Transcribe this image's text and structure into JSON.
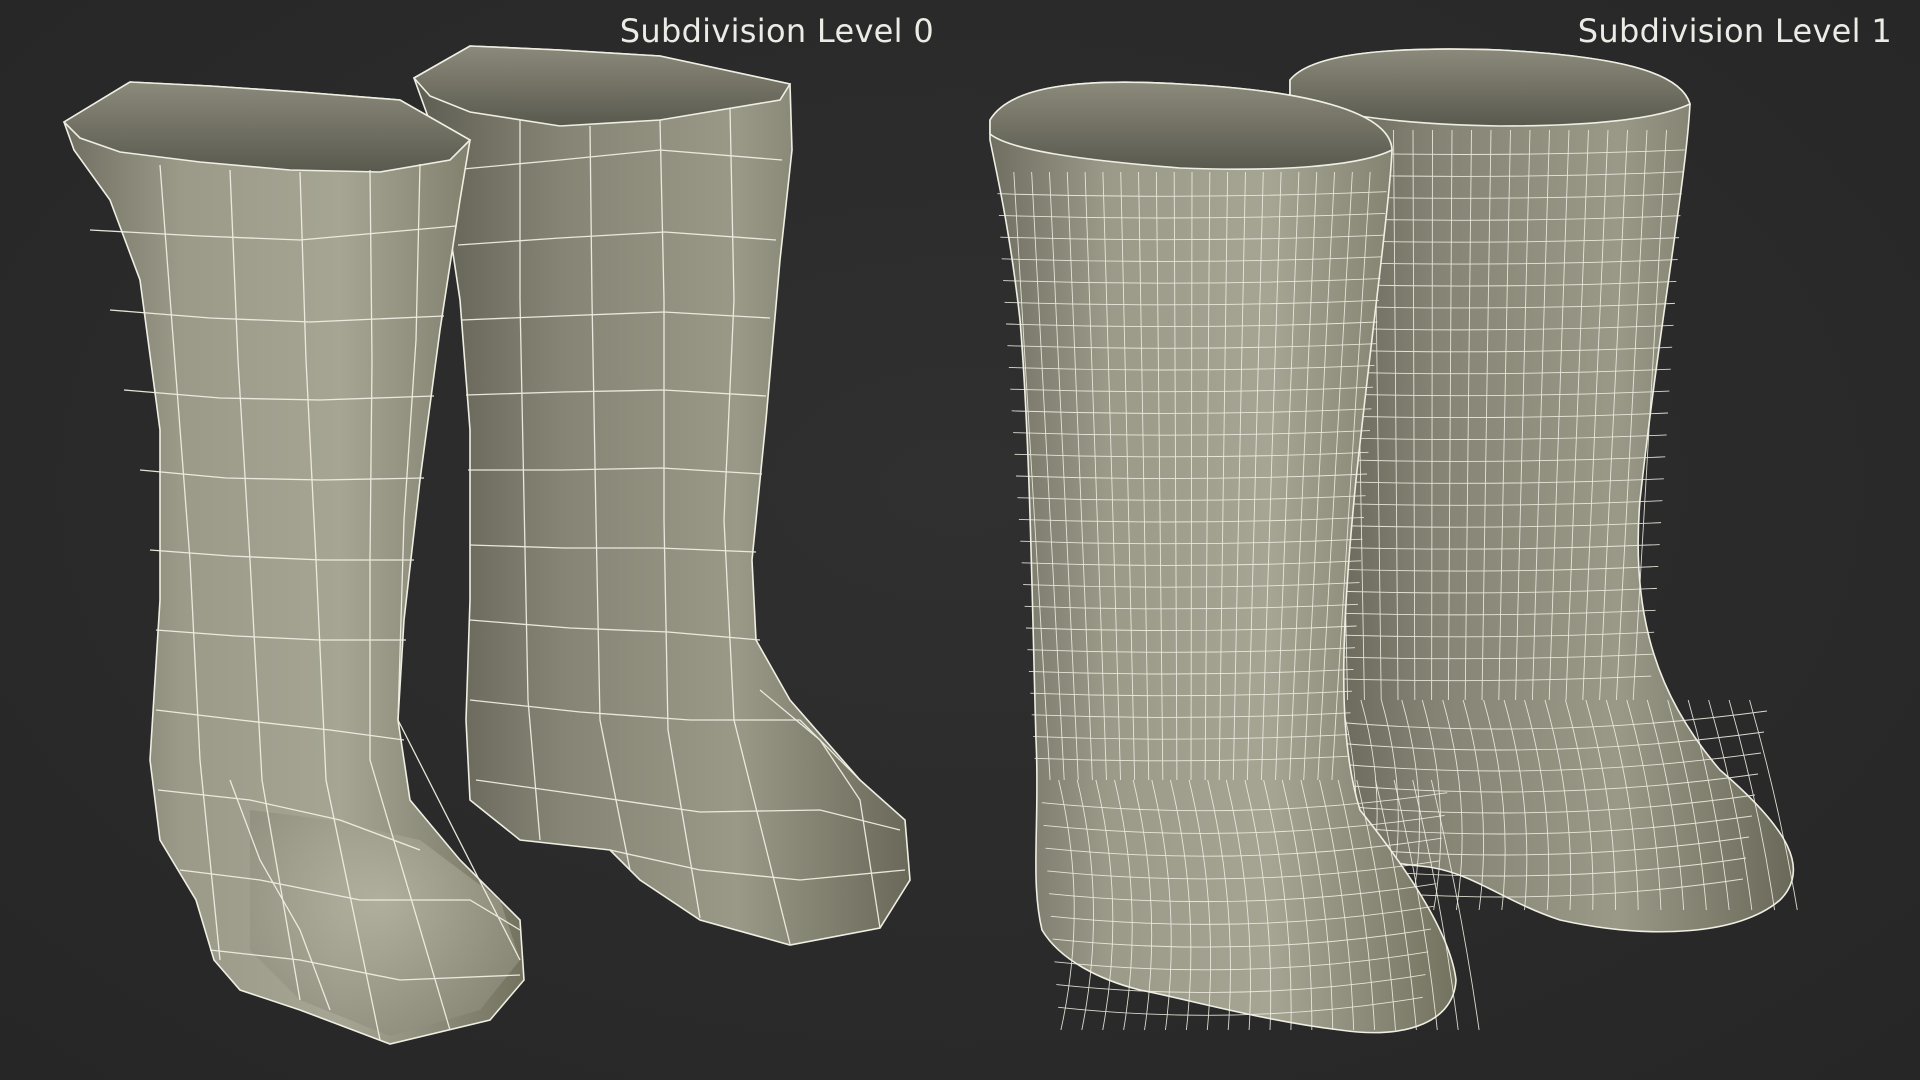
{
  "labels": {
    "left": "Subdivision Level 0",
    "right": "Subdivision Level 1"
  },
  "colors": {
    "background": "#2b2b2b",
    "boot_light": "#a9a897",
    "boot_mid": "#8d8c7c",
    "boot_dark": "#5f5e53",
    "wire": "#f2f1e6",
    "label": "#ecece6"
  },
  "icons": {
    "left_pair": "wireframe-boots-low-poly",
    "right_pair": "wireframe-boots-subdivided"
  }
}
